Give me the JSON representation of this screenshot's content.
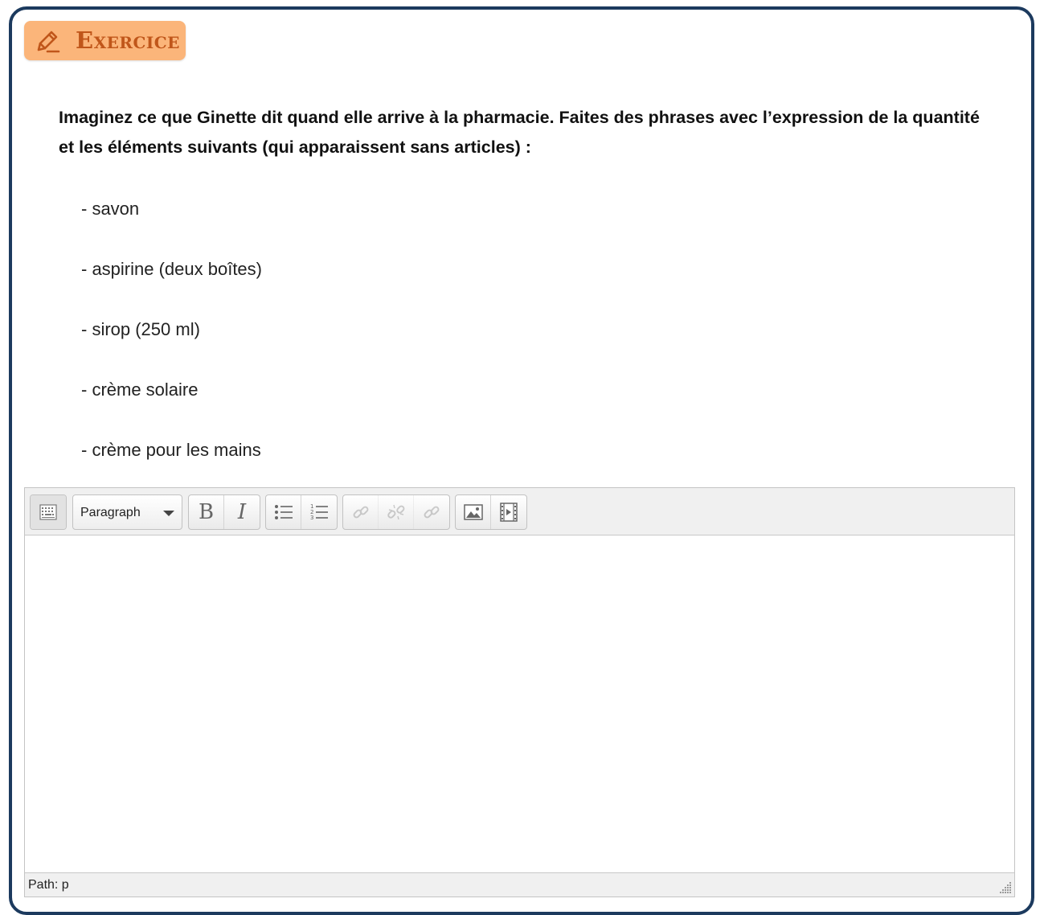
{
  "badge": {
    "icon": "pencil-icon",
    "label": "Exercice",
    "color": "#c0561a",
    "background": "#fbb57a"
  },
  "instructions": "Imaginez ce que Ginette dit quand elle arrive à la pharmacie. Faites des phrases avec l’expression de la quantité et les éléments suivants (qui apparaissent sans articles) :",
  "items": [
    "- savon",
    "- aspirine (deux boîtes)",
    "- sirop (250 ml)",
    "- crème solaire",
    "- crème pour les mains"
  ],
  "editor": {
    "toolbar": {
      "toggle_icon": "toolbar-toggle-icon",
      "format_select": "Paragraph",
      "bold_label": "B",
      "italic_label": "I",
      "icons": [
        "unordered-list-icon",
        "ordered-list-icon",
        "link-icon",
        "unlink-icon",
        "anchor-link-icon",
        "image-icon",
        "media-icon"
      ]
    },
    "content": "",
    "status_path": "Path: p"
  },
  "colors": {
    "frame_border": "#1c3a5e",
    "toolbar_bg": "#f0f0f0"
  }
}
